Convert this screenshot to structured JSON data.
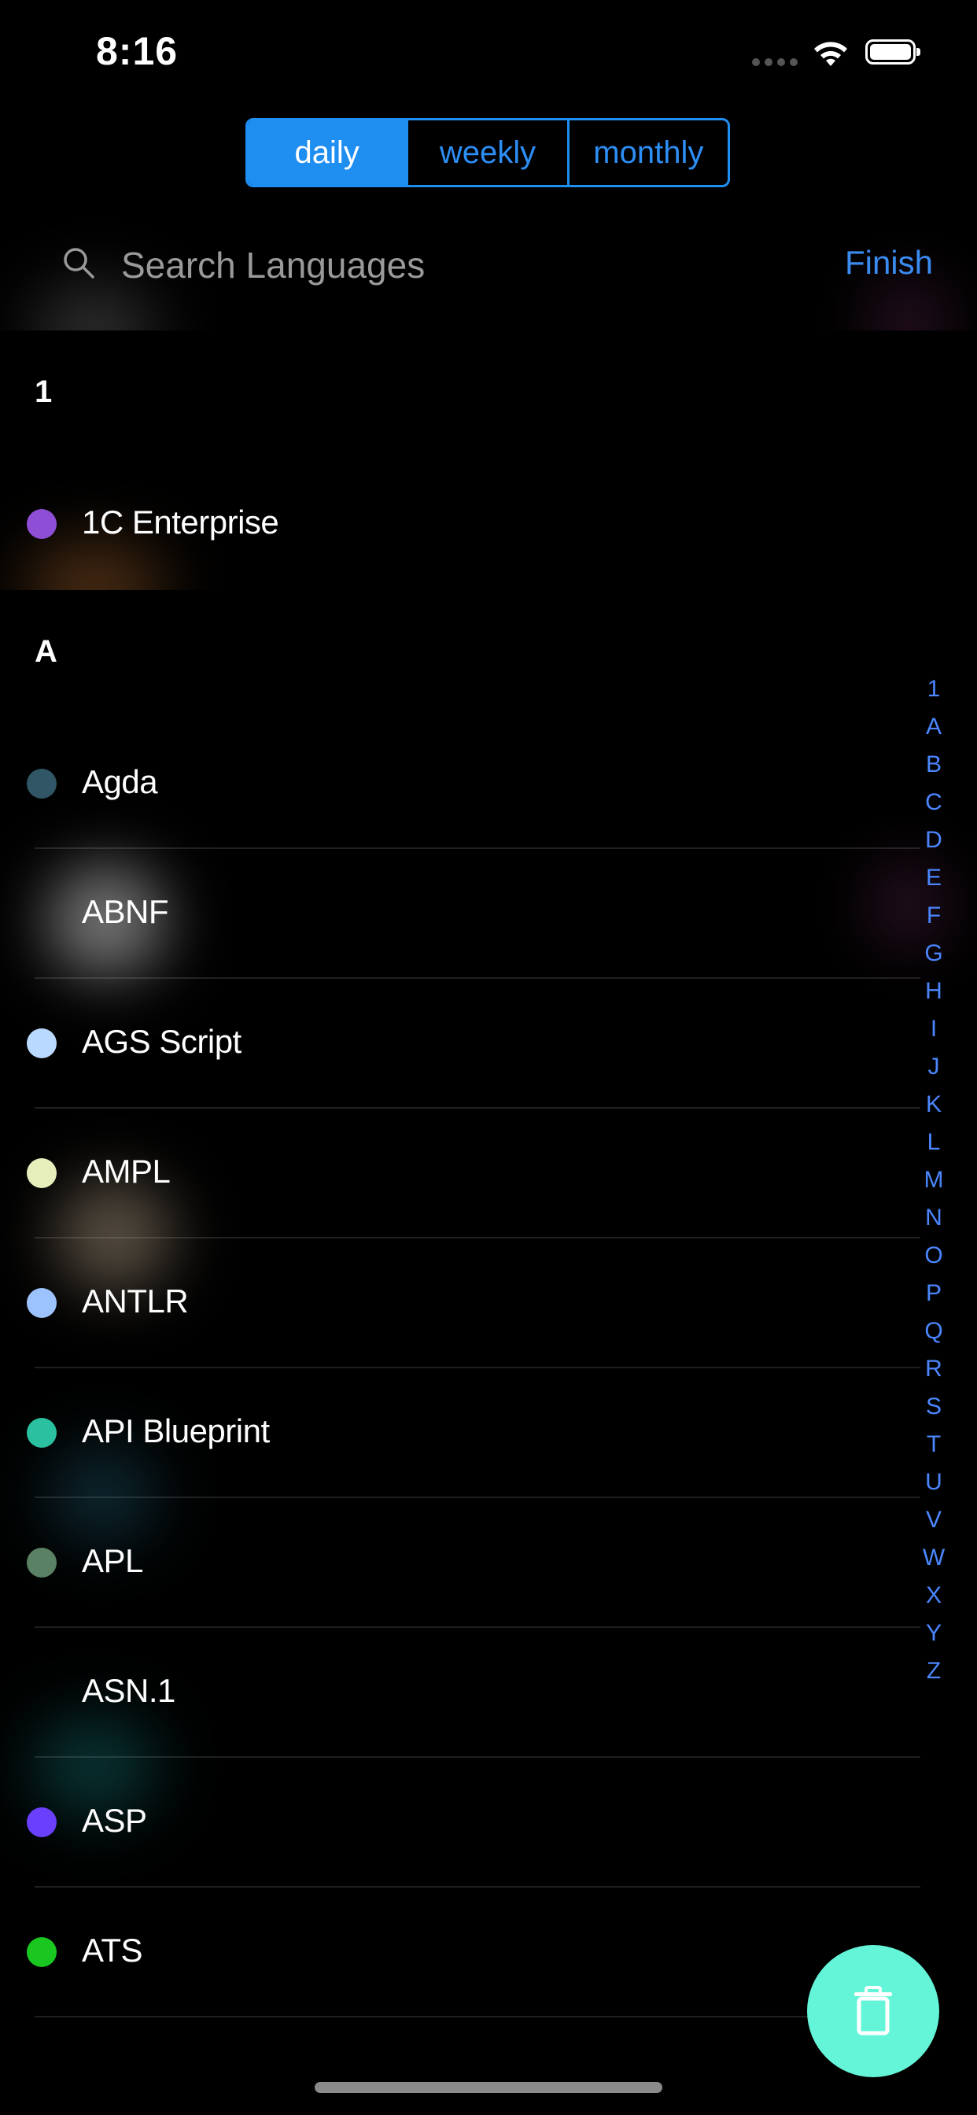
{
  "status_bar": {
    "time": "8:16"
  },
  "segmented": {
    "options": [
      {
        "label": "daily",
        "active": true
      },
      {
        "label": "weekly",
        "active": false
      },
      {
        "label": "monthly",
        "active": false
      }
    ]
  },
  "search": {
    "placeholder": "Search Languages",
    "finish_label": "Finish"
  },
  "sections": [
    {
      "title": "1",
      "items": [
        {
          "name": "1C Enterprise",
          "color": "#8e4fd6"
        }
      ]
    },
    {
      "title": "A",
      "items": [
        {
          "name": "Agda",
          "color": "#315665"
        },
        {
          "name": "ABNF",
          "color": ""
        },
        {
          "name": "AGS Script",
          "color": "#b9d9ff"
        },
        {
          "name": "AMPL",
          "color": "#e6efbb"
        },
        {
          "name": "ANTLR",
          "color": "#9dc3ff"
        },
        {
          "name": "API Blueprint",
          "color": "#2ac0a0"
        },
        {
          "name": "APL",
          "color": "#5a8164"
        },
        {
          "name": "ASN.1",
          "color": ""
        },
        {
          "name": "ASP",
          "color": "#6a40fd"
        },
        {
          "name": "ATS",
          "color": "#1ac620"
        }
      ]
    }
  ],
  "index_letters": [
    "1",
    "A",
    "B",
    "C",
    "D",
    "E",
    "F",
    "G",
    "H",
    "I",
    "J",
    "K",
    "L",
    "M",
    "N",
    "O",
    "P",
    "Q",
    "R",
    "S",
    "T",
    "U",
    "V",
    "W",
    "X",
    "Y",
    "Z"
  ],
  "fab": {
    "icon": "trash-icon",
    "color": "#64f5d9"
  }
}
